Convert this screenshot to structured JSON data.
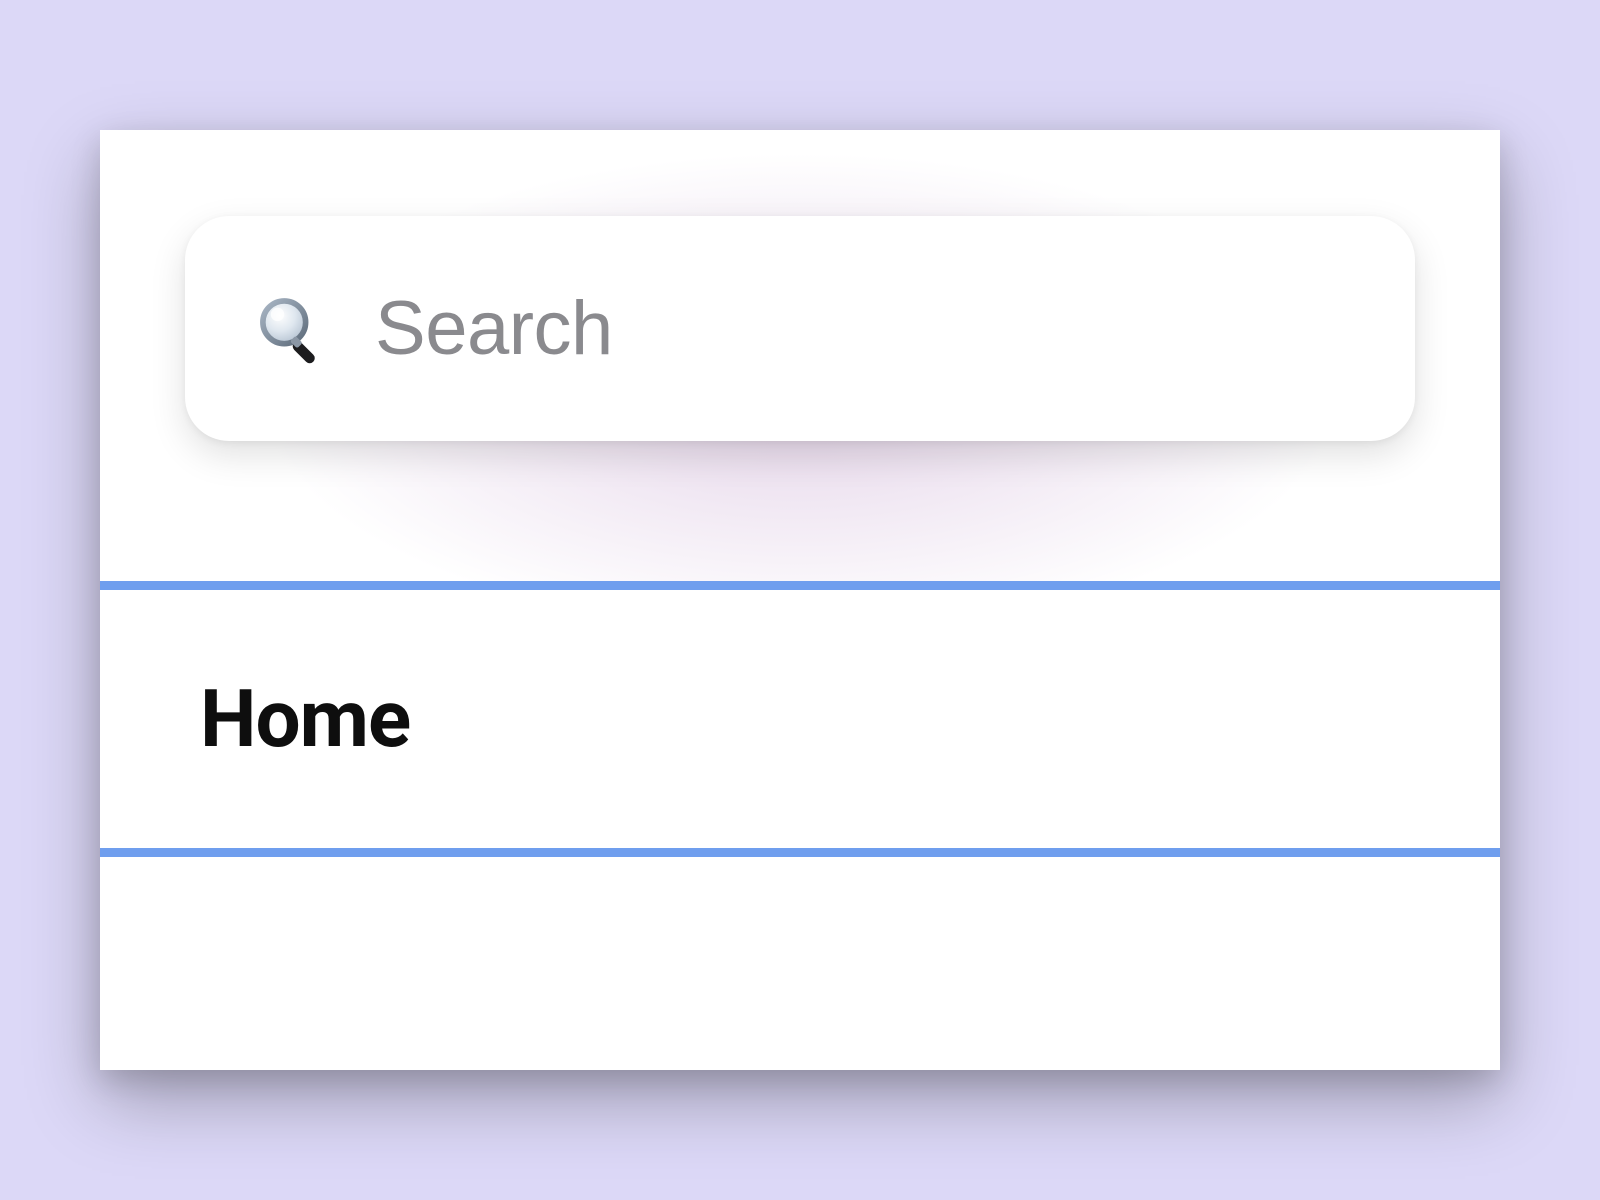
{
  "search": {
    "placeholder": "Search",
    "value": ""
  },
  "nav": {
    "items": [
      {
        "label": "Home"
      }
    ]
  },
  "colors": {
    "accent": "#6f9eee",
    "background": "#dcd8f7"
  }
}
